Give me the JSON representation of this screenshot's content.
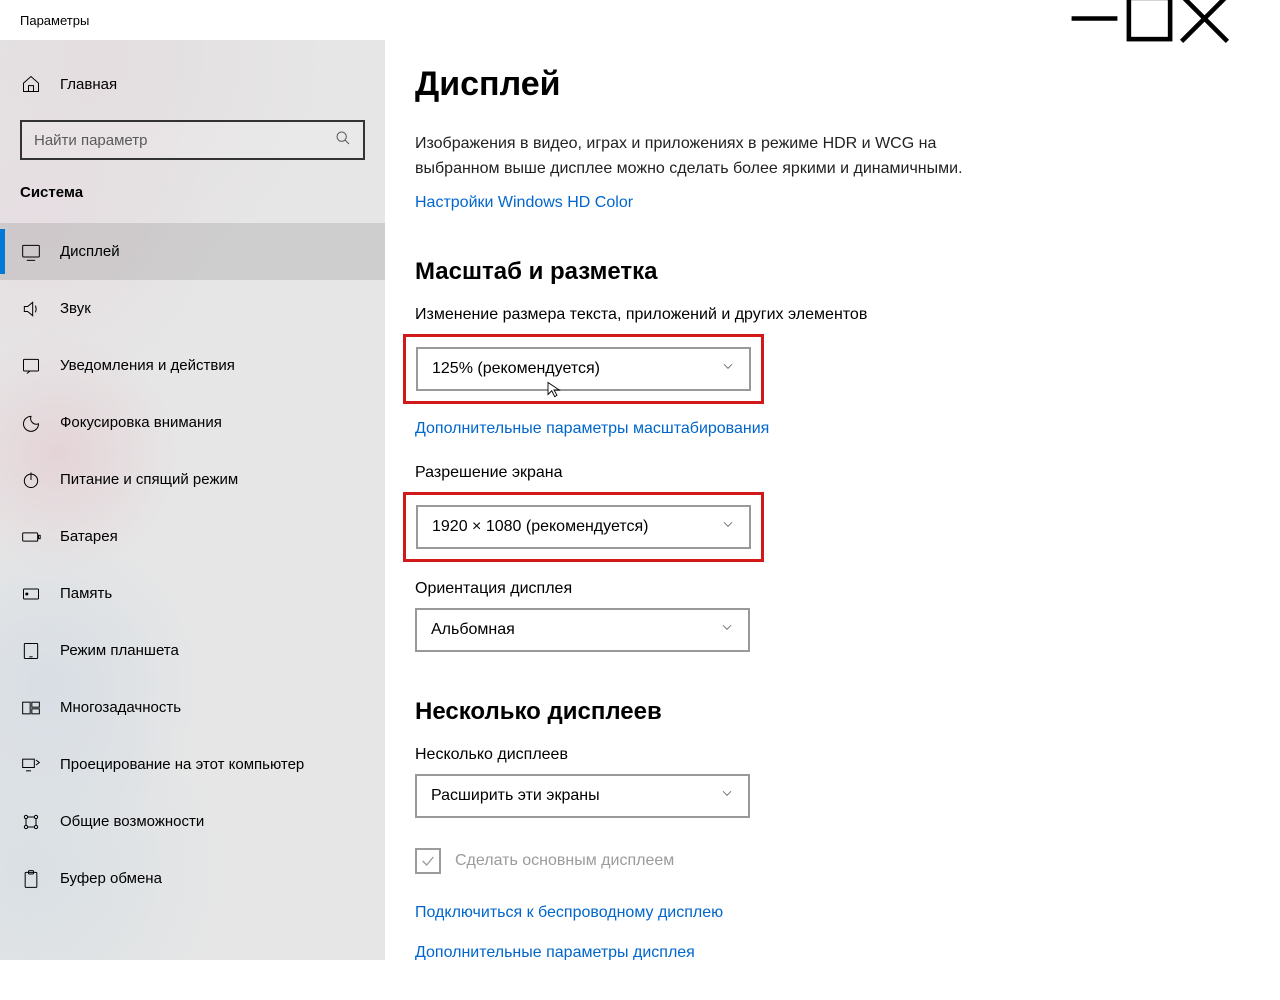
{
  "window": {
    "title": "Параметры"
  },
  "sidebar": {
    "home_label": "Главная",
    "search_placeholder": "Найти параметр",
    "section_label": "Система",
    "items": [
      {
        "label": "Дисплей"
      },
      {
        "label": "Звук"
      },
      {
        "label": "Уведомления и действия"
      },
      {
        "label": "Фокусировка внимания"
      },
      {
        "label": "Питание и спящий режим"
      },
      {
        "label": "Батарея"
      },
      {
        "label": "Память"
      },
      {
        "label": "Режим планшета"
      },
      {
        "label": "Многозадачность"
      },
      {
        "label": "Проецирование на этот компьютер"
      },
      {
        "label": "Общие возможности"
      },
      {
        "label": "Буфер обмена"
      }
    ]
  },
  "content": {
    "heading": "Дисплей",
    "hdr_desc": "Изображения в видео, играх и приложениях в режиме HDR и WCG на выбранном выше дисплее можно сделать более яркими и динамичными.",
    "hdr_link": "Настройки Windows HD Color",
    "scale_heading": "Масштаб и разметка",
    "scale_label": "Изменение размера текста, приложений и других элементов",
    "scale_value": "125% (рекомендуется)",
    "scale_link": "Дополнительные параметры масштабирования",
    "res_label": "Разрешение экрана",
    "res_value": "1920 × 1080 (рекомендуется)",
    "orient_label": "Ориентация дисплея",
    "orient_value": "Альбомная",
    "multi_heading": "Несколько дисплеев",
    "multi_label": "Несколько дисплеев",
    "multi_value": "Расширить эти экраны",
    "primary_checkbox": "Сделать основным дисплеем",
    "wireless_link": "Подключиться к беспроводному дисплею",
    "advanced_link": "Дополнительные параметры дисплея"
  }
}
